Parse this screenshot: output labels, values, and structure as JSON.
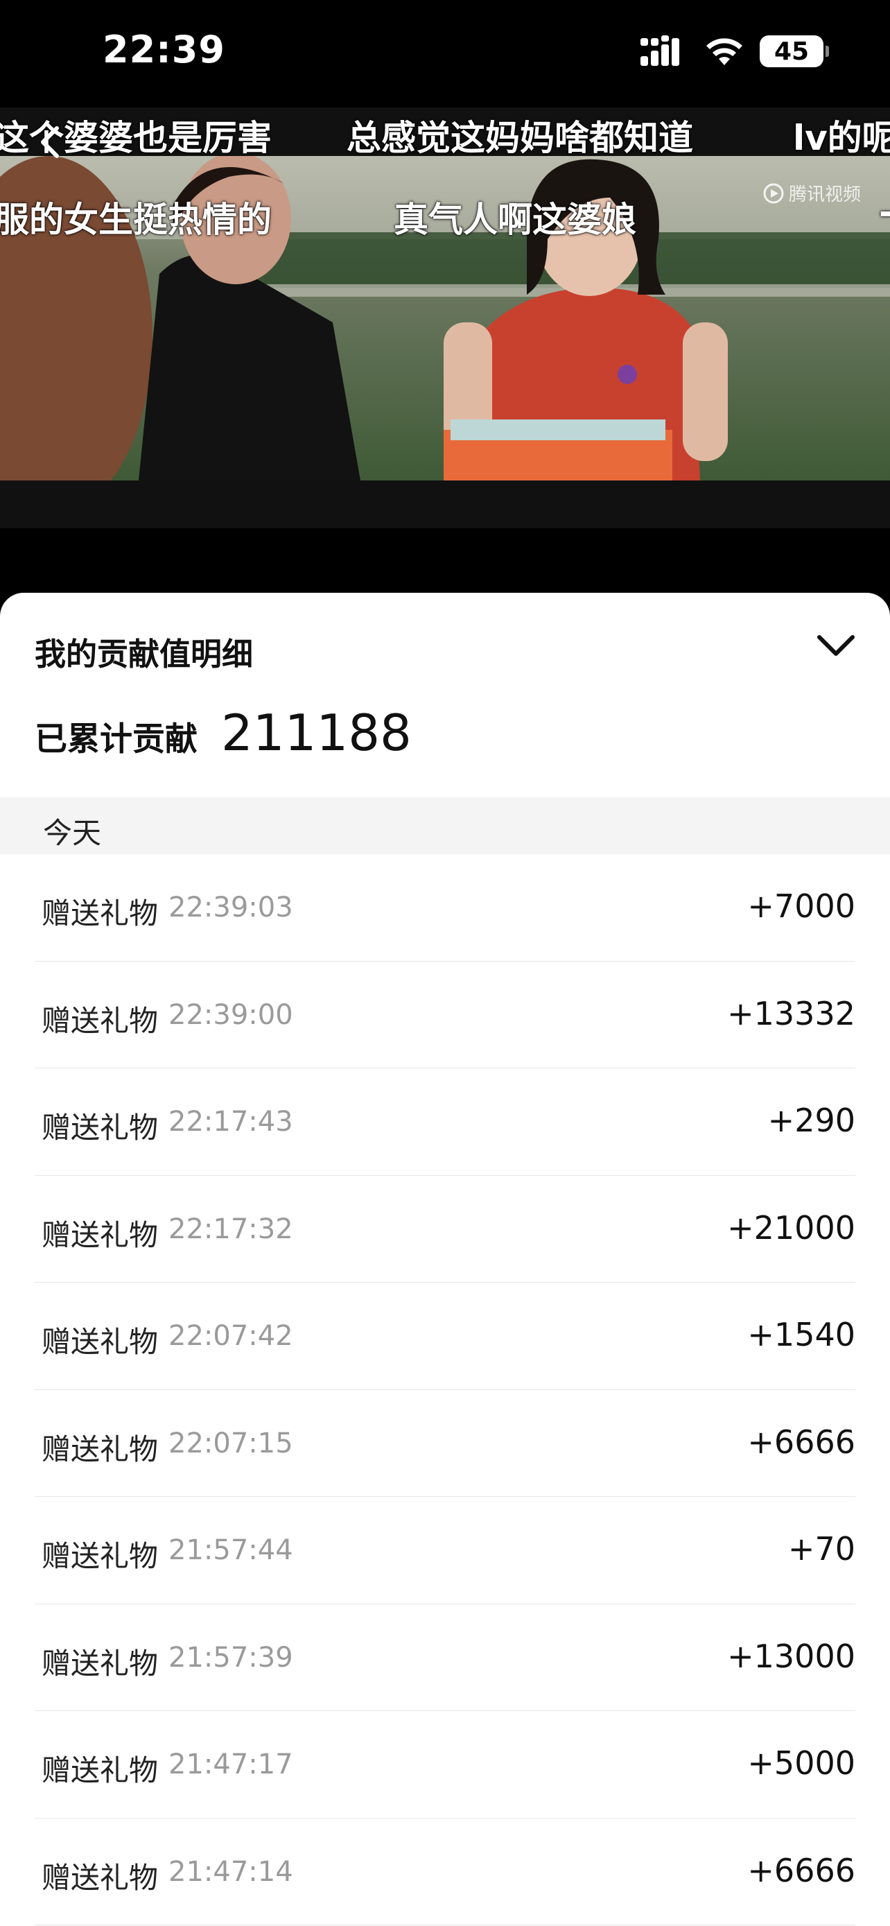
{
  "status_bar": {
    "time": "22:39",
    "battery": "45",
    "icons": [
      "signal-icon",
      "wifi-icon",
      "battery-icon"
    ]
  },
  "video": {
    "danmaku": [
      "这个婆婆也是厉害",
      "总感觉这妈妈啥都知道",
      "lv的呢",
      "服的女生挺热情的",
      "真气人啊这婆娘",
      "-"
    ],
    "watermark": "腾讯视频",
    "back_icon": "chevron-left-icon"
  },
  "sheet": {
    "title": "我的贡献值明细",
    "close_icon": "chevron-down-icon",
    "total_label": "已累计贡献",
    "total_value": "211188",
    "section_label": "今天",
    "records": [
      {
        "label": "赠送礼物",
        "time": "22:39:03",
        "amount": "+7000"
      },
      {
        "label": "赠送礼物",
        "time": "22:39:00",
        "amount": "+13332"
      },
      {
        "label": "赠送礼物",
        "time": "22:17:43",
        "amount": "+290"
      },
      {
        "label": "赠送礼物",
        "time": "22:17:32",
        "amount": "+21000"
      },
      {
        "label": "赠送礼物",
        "time": "22:07:42",
        "amount": "+1540"
      },
      {
        "label": "赠送礼物",
        "time": "22:07:15",
        "amount": "+6666"
      },
      {
        "label": "赠送礼物",
        "time": "21:57:44",
        "amount": "+70"
      },
      {
        "label": "赠送礼物",
        "time": "21:57:39",
        "amount": "+13000"
      },
      {
        "label": "赠送礼物",
        "time": "21:47:17",
        "amount": "+5000"
      },
      {
        "label": "赠送礼物",
        "time": "21:47:14",
        "amount": "+6666"
      }
    ]
  }
}
